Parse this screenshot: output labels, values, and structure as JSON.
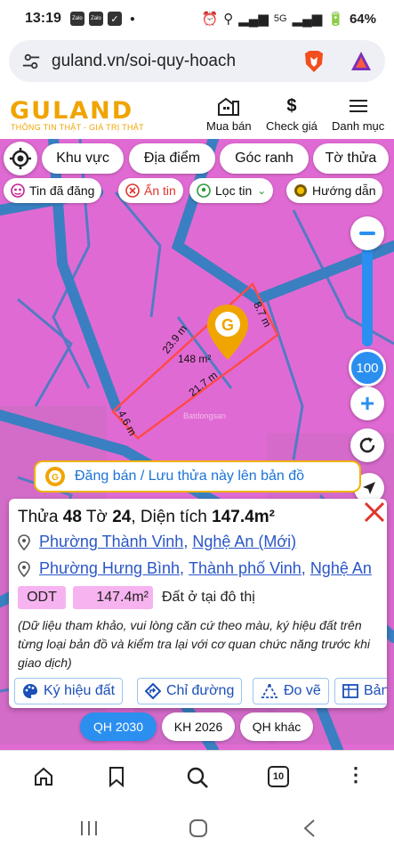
{
  "status": {
    "time": "13:19",
    "notif_icons": [
      "Zalo",
      "Zalo"
    ],
    "battery": "64%"
  },
  "browser": {
    "url": "guland.vn/soi-quy-hoach",
    "tab_count": "10"
  },
  "site": {
    "logo": "GULAND",
    "slogan": "THÔNG TIN THẬT - GIÁ TRỊ THẬT",
    "nav": [
      {
        "label": "Mua bán",
        "icon": "building-icon"
      },
      {
        "label": "Check giá",
        "icon": "dollar-icon"
      },
      {
        "label": "Danh mục",
        "icon": "menu-icon"
      }
    ]
  },
  "map": {
    "filters": [
      "Khu vực",
      "Địa điểm",
      "Góc ranh",
      "Tờ thửa"
    ],
    "toggles": {
      "posted": "Tin đã đăng",
      "hide": "Ẩn tin",
      "filter": "Lọc tin",
      "guide": "Hướng dẫn"
    },
    "zoom": "100",
    "parcel": {
      "area_label": "148 m²",
      "edges": [
        "23.9 m",
        "8.7 m",
        "21.7 m",
        "4.6 m"
      ],
      "marker": "G"
    },
    "watermark": "Batdongsan",
    "banner": "Đăng bán / Lưu thửa này lên bản đồ",
    "layers": [
      "QH 2030",
      "KH 2026",
      "QH khác"
    ]
  },
  "card": {
    "title_prefix": "Thửa",
    "parcel_no": "48",
    "sheet_prefix": "Tờ",
    "sheet_no": "24",
    "area_prefix": ", Diện tích",
    "area": "147.4m²",
    "new_address": {
      "ward": "Phường Thành Vinh",
      "province": "Nghệ An (Mới)"
    },
    "old_address": {
      "ward": "Phường Hưng Bình",
      "city": "Thành phố Vinh",
      "province": "Nghệ An"
    },
    "land_use": {
      "code": "ODT",
      "area": "147.4m²",
      "description": "Đất ở tại đô thị"
    },
    "note": "(Dữ liệu tham khảo, vui lòng căn cứ theo màu, ký hiệu đất trên từng loại bản đồ và kiểm tra lại với cơ quan chức năng trước khi giao dịch)",
    "tools": [
      "Ký hiệu đất",
      "Chỉ đường",
      "Đo vẽ",
      "Bảng"
    ]
  },
  "colors": {
    "brand": "#f0a400",
    "land_residential": "#e06ad3",
    "road": "#3a7fc1",
    "accent_blue": "#2b8ff0"
  }
}
